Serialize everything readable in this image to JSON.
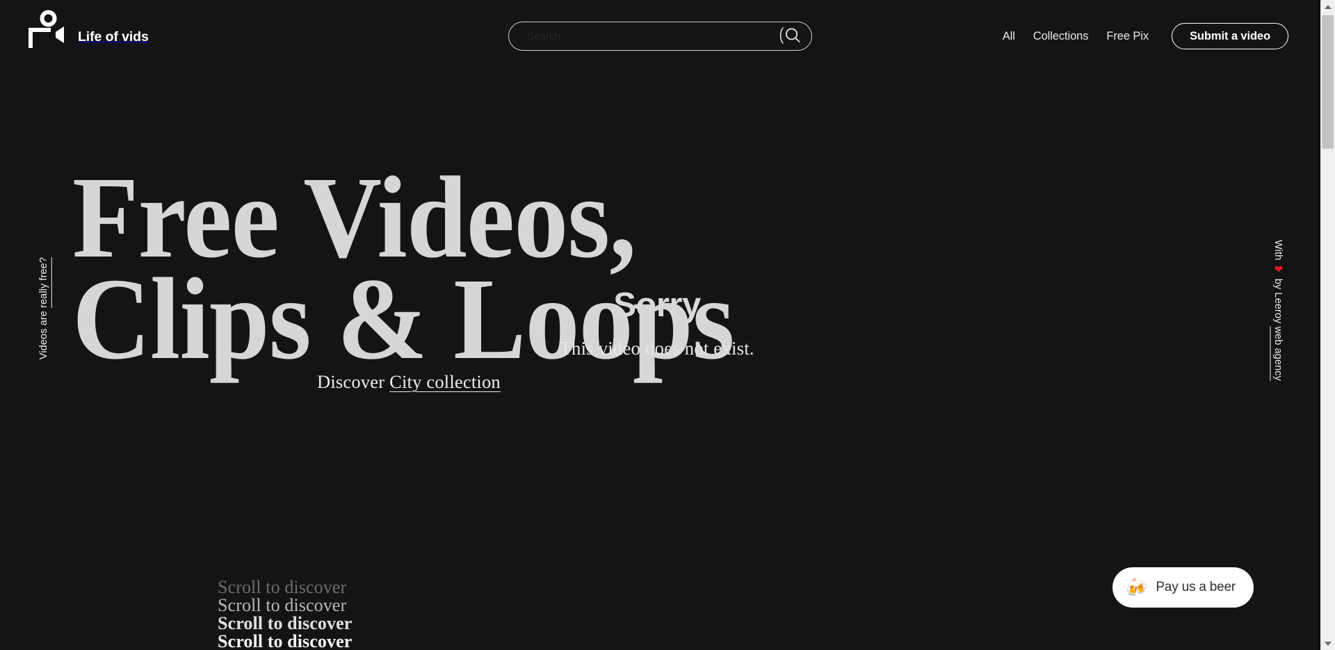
{
  "brand": {
    "name": "Life of vids",
    "logo_icon": "person-camera-logo-icon"
  },
  "search": {
    "value": "",
    "placeholder": "Search",
    "button_icon": "search-icon"
  },
  "nav": {
    "links": [
      {
        "label": "All"
      },
      {
        "label": "Collections"
      },
      {
        "label": "Free Pix"
      }
    ],
    "submit_label": "Submit a video"
  },
  "side": {
    "left_prefix": "Videos are ",
    "left_underlined": "really free?",
    "right_prefix": "With ",
    "right_heart": "❤",
    "right_mid": " by Leeroy ",
    "right_underlined": "web agency"
  },
  "hero": {
    "headline_line1": "Free Videos,",
    "headline_line2": "Clips & Loops",
    "discover_prefix": "Discover ",
    "discover_link": "City collection"
  },
  "video_error": {
    "title": "Sorry",
    "message": "This video does not exist."
  },
  "scroll_hint": {
    "lines": [
      "Scroll to discover",
      "Scroll to discover",
      "Scroll to discover",
      "Scroll to discover"
    ]
  },
  "beer": {
    "emoji": "🍻",
    "label": "Pay us a beer"
  },
  "colors": {
    "background": "#141414",
    "text": "#e8e8e8",
    "headline": "#d6d6d6",
    "heart": "#e51c23",
    "beer_bg": "#ffffff",
    "scrollbar_track": "#f0f0f0",
    "scrollbar_thumb": "#c2c2c2"
  }
}
